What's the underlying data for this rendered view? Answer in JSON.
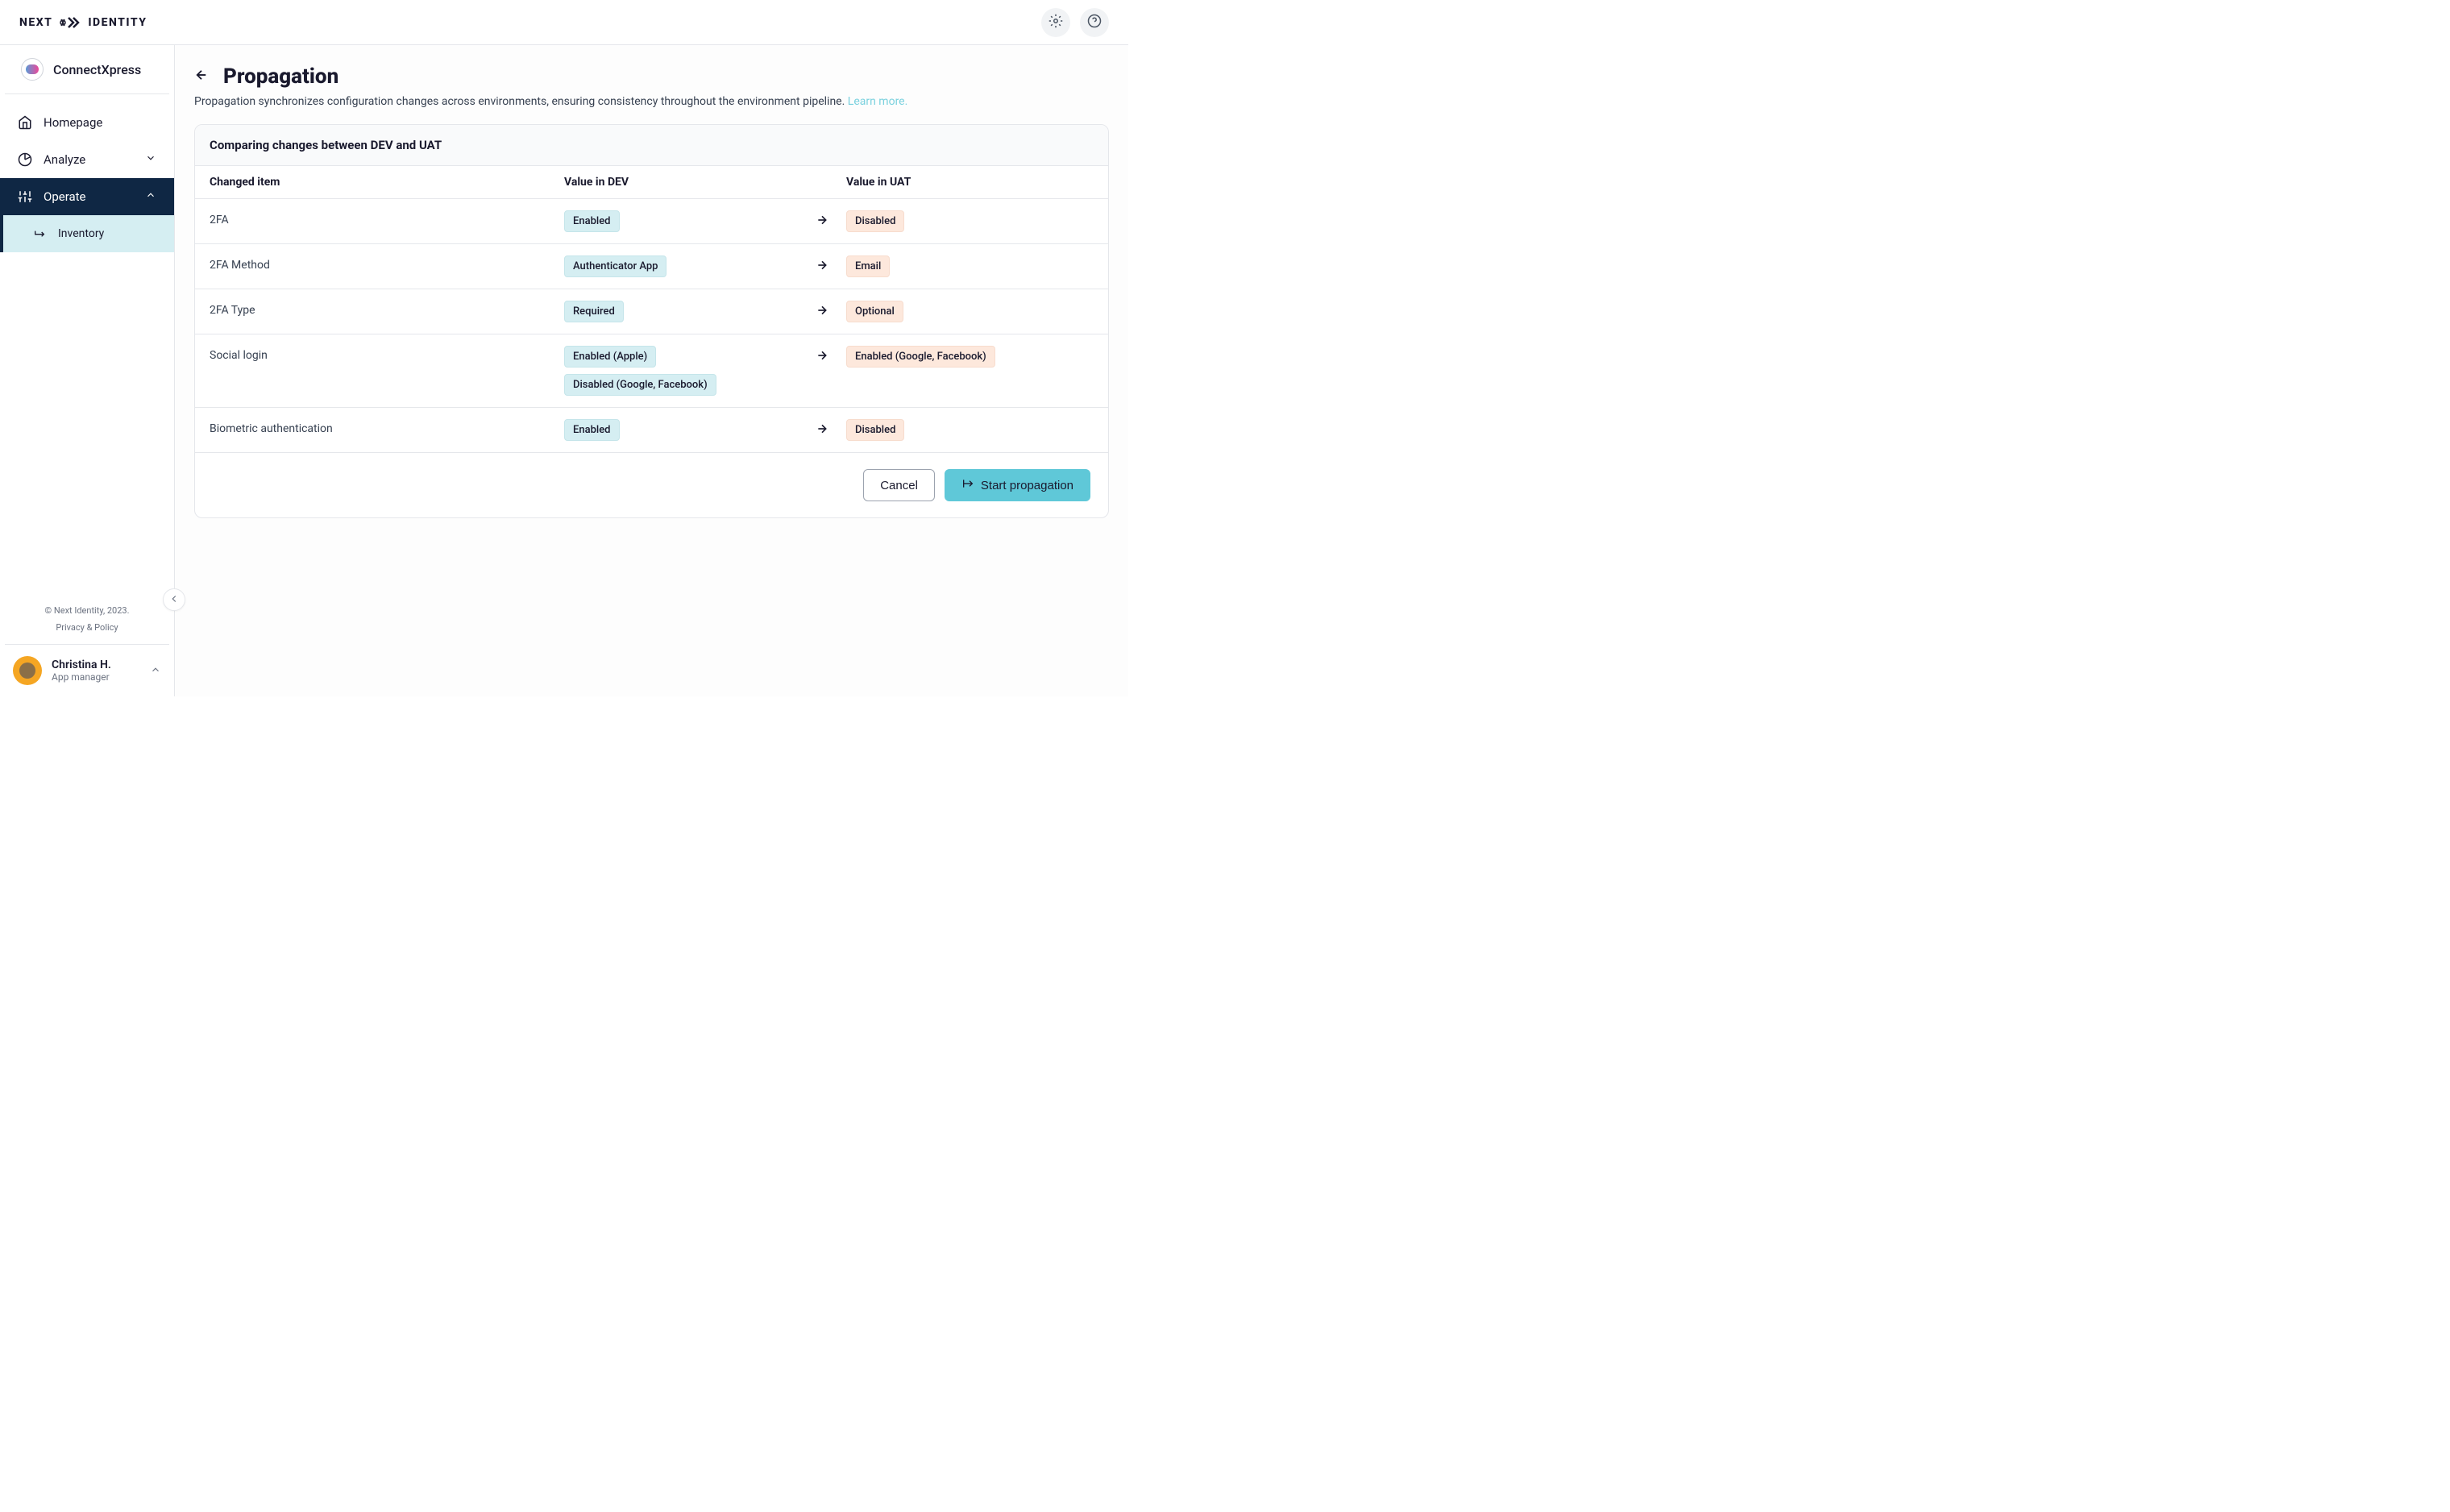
{
  "header": {
    "logo_next": "NEXT",
    "logo_identity": "IDENTITY"
  },
  "sidebar": {
    "project_name": "ConnectXpress",
    "nav": {
      "homepage": "Homepage",
      "analyze": "Analyze",
      "operate": "Operate",
      "inventory": "Inventory"
    },
    "copyright": "© Next Identity, 2023.",
    "privacy": "Privacy & Policy",
    "user": {
      "name": "Christina H.",
      "role": "App manager"
    }
  },
  "page": {
    "title": "Propagation",
    "description": "Propagation synchronizes configuration changes across environments, ensuring consistency throughout the environment pipeline. ",
    "learn_more": "Learn more.",
    "card_title": "Comparing changes between DEV and UAT",
    "columns": {
      "changed_item": "Changed item",
      "value_dev": "Value in DEV",
      "value_uat": "Value in UAT"
    },
    "rows": [
      {
        "item": "2FA",
        "dev": [
          "Enabled"
        ],
        "uat": [
          "Disabled"
        ]
      },
      {
        "item": "2FA Method",
        "dev": [
          "Authenticator App"
        ],
        "uat": [
          "Email"
        ]
      },
      {
        "item": "2FA Type",
        "dev": [
          "Required"
        ],
        "uat": [
          "Optional"
        ]
      },
      {
        "item": "Social login",
        "dev": [
          "Enabled (Apple)",
          "Disabled (Google, Facebook)"
        ],
        "uat": [
          "Enabled (Google, Facebook)"
        ]
      },
      {
        "item": "Biometric authentication",
        "dev": [
          "Enabled"
        ],
        "uat": [
          "Disabled"
        ]
      }
    ],
    "buttons": {
      "cancel": "Cancel",
      "start": "Start propagation"
    }
  }
}
